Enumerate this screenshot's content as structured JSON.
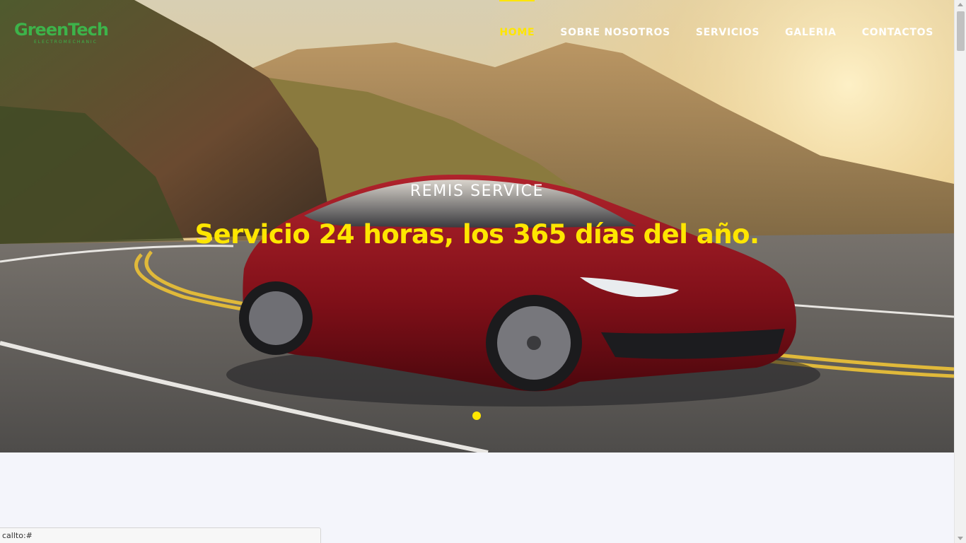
{
  "brand": {
    "name": "GreenTech",
    "tagline": "ELECTROMECHANIC"
  },
  "nav": {
    "items": [
      {
        "label": "HOME",
        "active": true
      },
      {
        "label": "SOBRE NOSOTROS",
        "active": false
      },
      {
        "label": "SERVICIOS",
        "active": false
      },
      {
        "label": "GALERIA",
        "active": false
      },
      {
        "label": "CONTACTOS",
        "active": false
      }
    ]
  },
  "hero": {
    "subtitle": "REMIS SERVICE",
    "title": "Servicio 24 horas, los 365 días del año.",
    "slide_count": 1,
    "active_slide": 1
  },
  "status_bar": {
    "text": "callto:#"
  },
  "colors": {
    "accent": "#ffe600",
    "brand_green": "#3db34a",
    "page_background": "#f4f5fb"
  }
}
